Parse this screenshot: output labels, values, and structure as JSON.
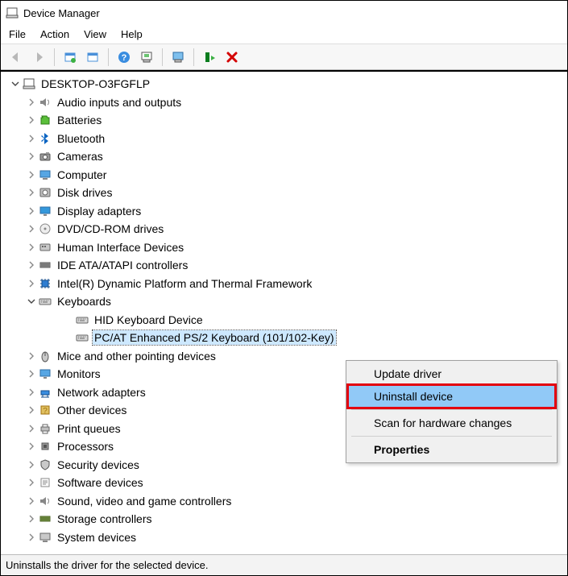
{
  "title": "Device Manager",
  "menubar": {
    "items": [
      "File",
      "Action",
      "View",
      "Help"
    ]
  },
  "toolbar": {
    "back": "Back",
    "forward": "Forward",
    "properties_all": "Show hidden devices",
    "refresh": "Refresh",
    "help": "Help",
    "scan": "Scan for hardware changes",
    "update": "Update driver",
    "install": "Install",
    "uninstall": "Uninstall device"
  },
  "root": {
    "name": "DESKTOP-O3FGFLP"
  },
  "categories": [
    {
      "name": "Audio inputs and outputs",
      "icon": "speaker"
    },
    {
      "name": "Batteries",
      "icon": "battery"
    },
    {
      "name": "Bluetooth",
      "icon": "bluetooth"
    },
    {
      "name": "Cameras",
      "icon": "camera"
    },
    {
      "name": "Computer",
      "icon": "computer"
    },
    {
      "name": "Disk drives",
      "icon": "disk"
    },
    {
      "name": "Display adapters",
      "icon": "display"
    },
    {
      "name": "DVD/CD-ROM drives",
      "icon": "cd"
    },
    {
      "name": "Human Interface Devices",
      "icon": "hid"
    },
    {
      "name": "IDE ATA/ATAPI controllers",
      "icon": "ide"
    },
    {
      "name": "Intel(R) Dynamic Platform and Thermal Framework",
      "icon": "chip"
    },
    {
      "name": "Keyboards",
      "icon": "keyboard",
      "expanded": true,
      "children": [
        {
          "name": "HID Keyboard Device",
          "icon": "keyboard"
        },
        {
          "name": "PC/AT Enhanced PS/2 Keyboard (101/102-Key)",
          "icon": "keyboard",
          "selected": true
        }
      ]
    },
    {
      "name": "Mice and other pointing devices",
      "icon": "mouse"
    },
    {
      "name": "Monitors",
      "icon": "monitor"
    },
    {
      "name": "Network adapters",
      "icon": "network"
    },
    {
      "name": "Other devices",
      "icon": "other"
    },
    {
      "name": "Print queues",
      "icon": "printer"
    },
    {
      "name": "Processors",
      "icon": "cpu"
    },
    {
      "name": "Security devices",
      "icon": "security"
    },
    {
      "name": "Software devices",
      "icon": "software"
    },
    {
      "name": "Sound, video and game controllers",
      "icon": "sound"
    },
    {
      "name": "Storage controllers",
      "icon": "storage"
    },
    {
      "name": "System devices",
      "icon": "system"
    }
  ],
  "context_menu": {
    "items": [
      {
        "label": "Update driver"
      },
      {
        "label": "Uninstall device",
        "highlighted": true
      },
      {
        "sep": true
      },
      {
        "label": "Scan for hardware changes"
      },
      {
        "sep": true
      },
      {
        "label": "Properties",
        "bold": true
      }
    ]
  },
  "statusbar": {
    "text": "Uninstalls the driver for the selected device."
  }
}
